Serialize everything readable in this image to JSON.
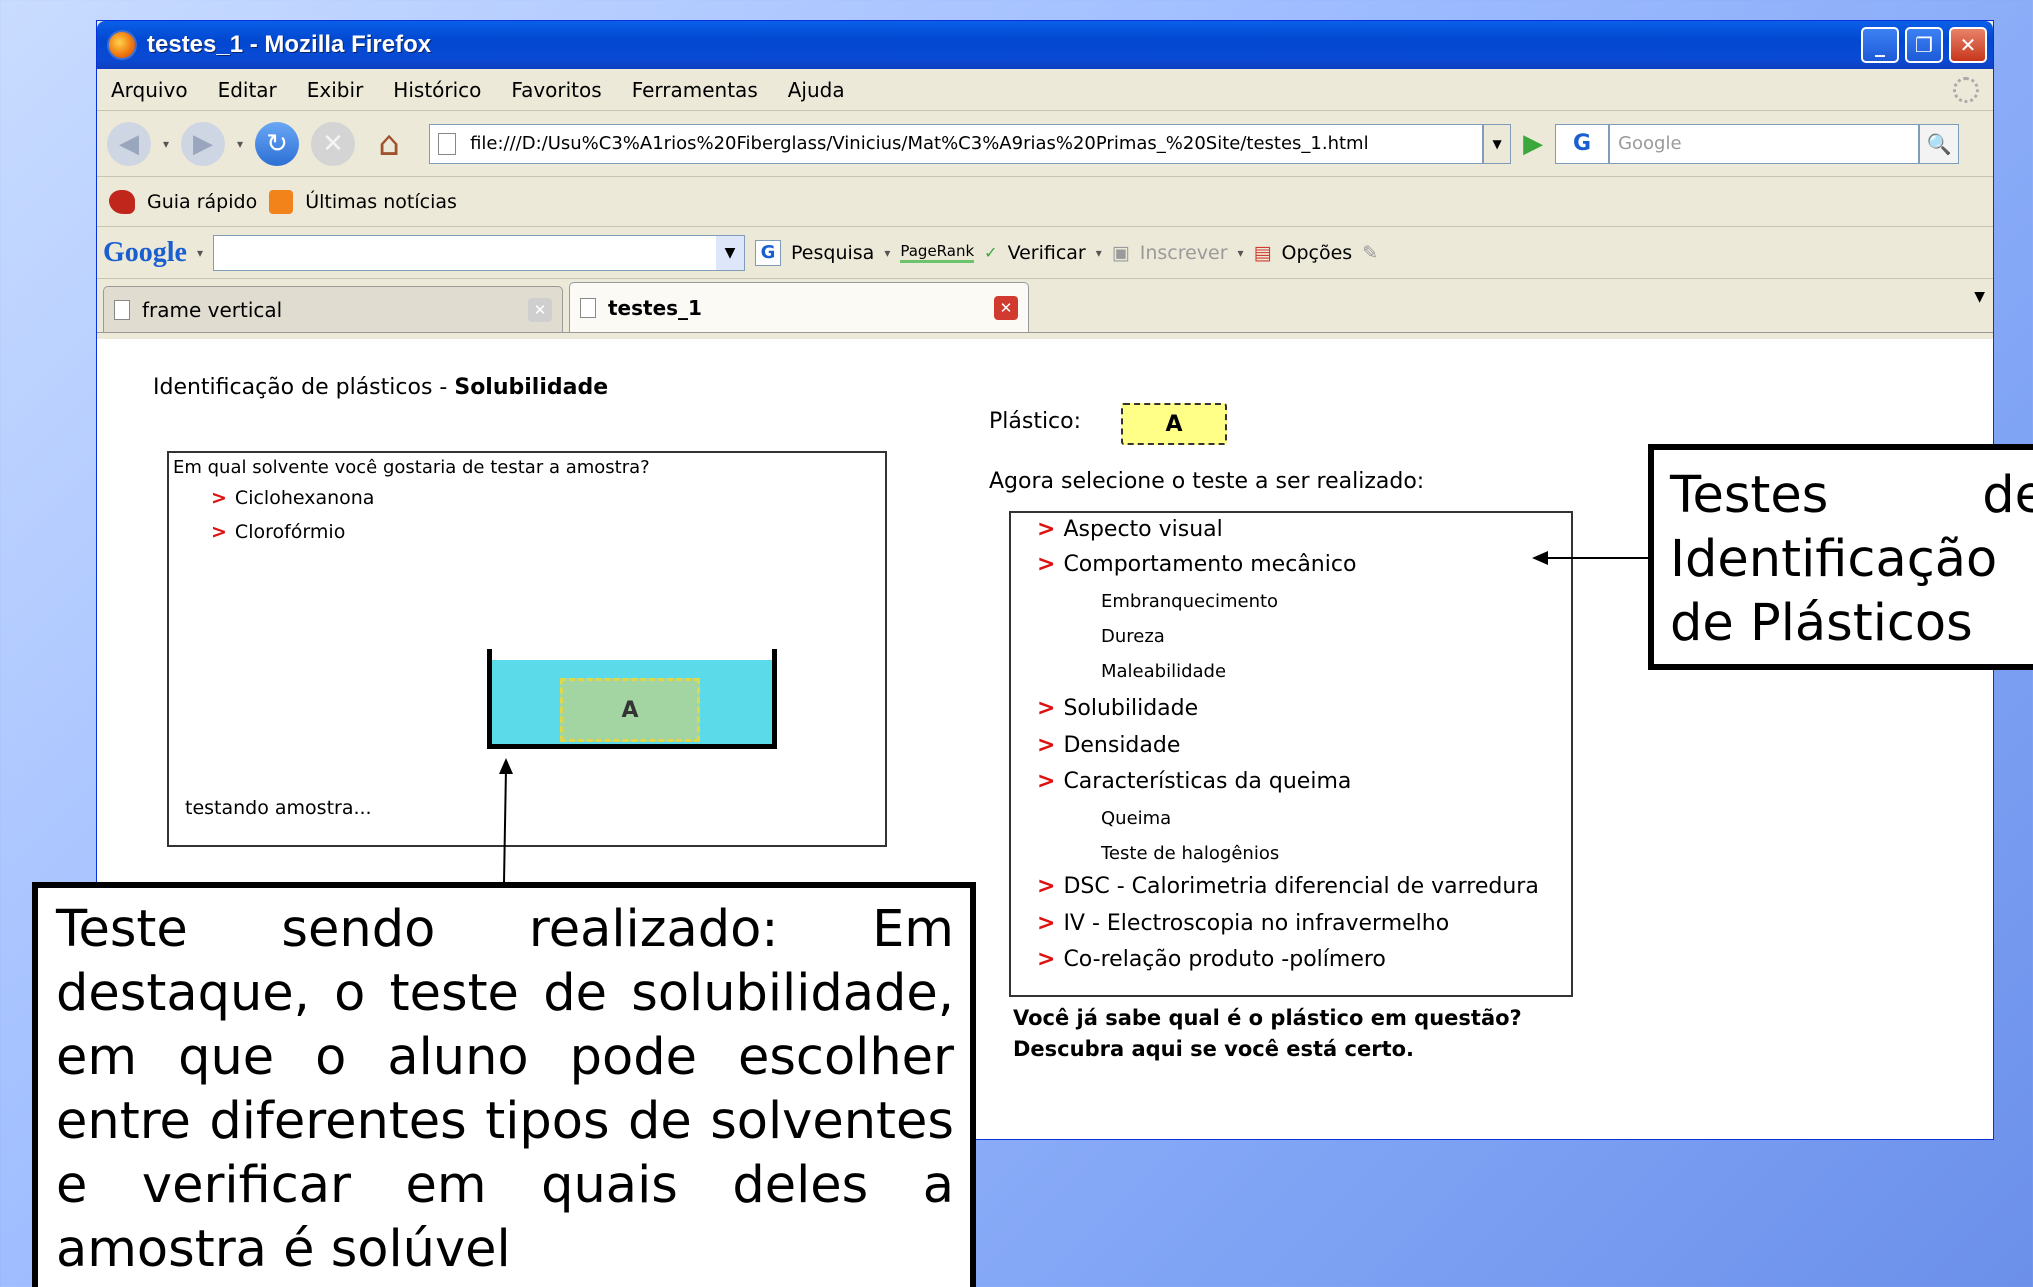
{
  "window": {
    "title": "testes_1 - Mozilla Firefox"
  },
  "menu": [
    "Arquivo",
    "Editar",
    "Exibir",
    "Histórico",
    "Favoritos",
    "Ferramentas",
    "Ajuda"
  ],
  "nav": {
    "url": "file:///D:/Usu%C3%A1rios%20Fiberglass/Vinicius/Mat%C3%A9rias%20Primas_%20Site/testes_1.html",
    "search_placeholder": "Google"
  },
  "bookmarks": {
    "item1": "Guia rápido",
    "item2": "Últimas notícias"
  },
  "google_toolbar": {
    "logo": "Google",
    "search": "Pesquisa",
    "pagerank": "PageRank",
    "check": "Verificar",
    "subscribe": "Inscrever",
    "options": "Opções"
  },
  "tabs": [
    {
      "label": "frame vertical"
    },
    {
      "label": "testes_1"
    }
  ],
  "page": {
    "title_prefix": "Identificação de plásticos - ",
    "title_bold": "Solubilidade",
    "question": "Em qual solvente você gostaria de testar a amostra?",
    "solvents": [
      "Ciclohexanona",
      "Clorofórmio"
    ],
    "sample_label": "A",
    "testing_text": "testando amostra...",
    "plastic_label": "Plástico:",
    "plastic_value": "A",
    "select_prompt": "Agora selecione o teste a ser realizado:",
    "tests": {
      "t1": "Aspecto visual",
      "t2": "Comportamento mecânico",
      "s1": "Embranquecimento",
      "s2": "Dureza",
      "s3": "Maleabilidade",
      "t3": "Solubilidade",
      "t4": "Densidade",
      "t5": "Características da queima",
      "s4": "Queima",
      "s5": "Teste de halogênios",
      "t6": "DSC - Calorimetria diferencial de varredura",
      "t7": "IV - Electroscopia no infravermelho",
      "t8": "Co-relação produto -polímero"
    },
    "arrow_glyph": ">",
    "question_line1": "Você já sabe qual é o plástico em questão?",
    "question_line2": "Descubra aqui se você está certo."
  },
  "callouts": {
    "left": "Teste sendo realizado: Em destaque, o teste de solubilidade, em que o aluno pode escolher entre diferentes tipos de solventes e verificar em quais deles a amostra é solúvel",
    "right": "Testes de Identificação de Plásticos"
  }
}
